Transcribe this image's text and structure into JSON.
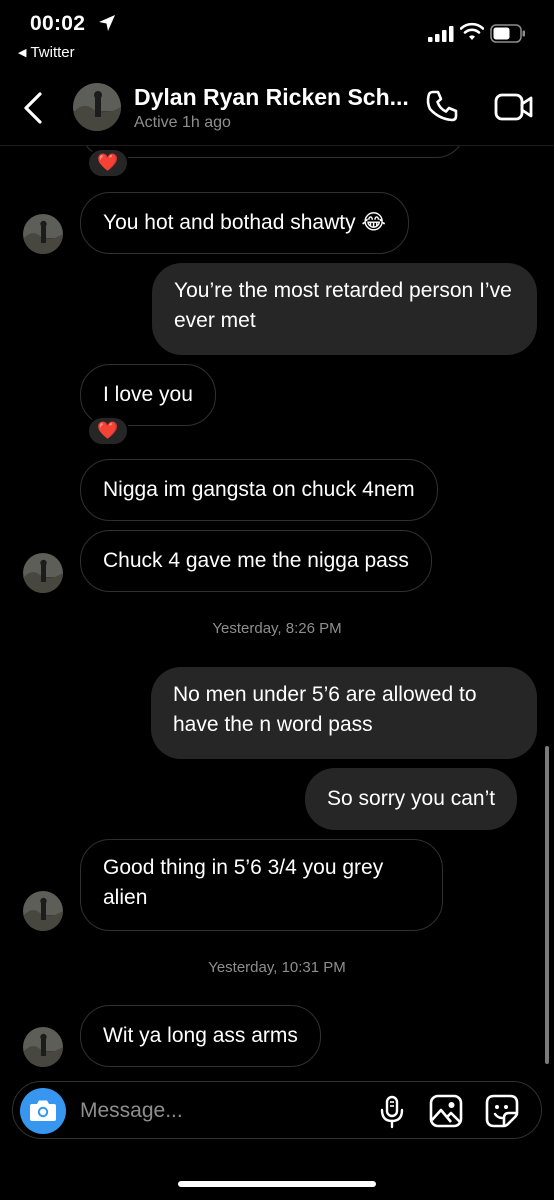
{
  "status_bar": {
    "time": "00:02",
    "back_app": "Twitter",
    "back_arrow": "◀"
  },
  "header": {
    "name": "Dylan Ryan Ricken Sch...",
    "status": "Active 1h ago"
  },
  "messages": [
    {
      "text": "You hot and bothad shawty 😂",
      "from": "them"
    },
    {
      "text": "You’re the most retarded person I’ve ever met",
      "from": "me"
    },
    {
      "text": "I love you",
      "from": "them",
      "reaction": "❤️"
    },
    {
      "text": "Nigga im gangsta on chuck 4nem",
      "from": "them"
    },
    {
      "text": "Chuck 4 gave me the nigga pass",
      "from": "them"
    },
    {
      "text": "No men under 5’6 are allowed to have the n word pass",
      "from": "me"
    },
    {
      "text": "So sorry you can’t",
      "from": "me"
    },
    {
      "text": "Good thing in 5’6 3/4 you grey alien",
      "from": "them"
    },
    {
      "text": "Wit ya long ass arms",
      "from": "them"
    }
  ],
  "timestamps": [
    "Yesterday, 8:26 PM",
    "Yesterday, 10:31 PM"
  ],
  "reactions": {
    "top": "❤️"
  },
  "composer": {
    "placeholder": "Message..."
  },
  "icons": {
    "back": "chevron-left-icon",
    "call": "phone-icon",
    "video": "video-camera-icon",
    "camera": "camera-icon",
    "mic": "microphone-icon",
    "gallery": "image-icon",
    "sticker": "sticker-icon"
  },
  "colors": {
    "background": "#000000",
    "outgoing_bubble": "#262626",
    "incoming_border": "#303030",
    "accent": "#3797f0",
    "secondary_text": "#8e8e8e",
    "heart": "#e8273f"
  }
}
